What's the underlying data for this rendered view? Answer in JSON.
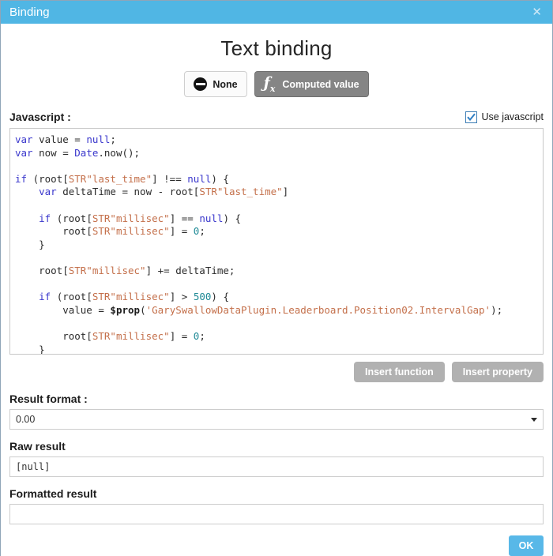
{
  "window": {
    "title": "Binding",
    "close_icon": "close-icon",
    "titlebar_color": "#50b6e4"
  },
  "heading": "Text binding",
  "mode_buttons": [
    {
      "label": "None",
      "icon": "no-entry-icon",
      "selected": false
    },
    {
      "label": "Computed value",
      "icon": "fx-icon",
      "selected": true
    }
  ],
  "javascript_section": {
    "label": "Javascript :",
    "use_javascript_label": "Use javascript",
    "use_javascript_checked": true,
    "code": "var value = null;\nvar now = Date.now();\n\nif (root[\"last_time\"] !== null) {\n    var deltaTime = now - root[\"last_time\"]\n\n    if (root[\"millisec\"] == null) {\n        root[\"millisec\"] = 0;\n    }\n\n    root[\"millisec\"] += deltaTime;\n\n    if (root[\"millisec\"] > 500) {\n        value = $prop('GarySwallowDataPlugin.Leaderboard.Position02.IntervalGap');\n\n        root[\"millisec\"] = 0;\n    }\n}\nroot[\"last_time\"] = now;\nreturn value;"
  },
  "insert_buttons": {
    "insert_function": "Insert function",
    "insert_property": "Insert property"
  },
  "result_format": {
    "label": "Result format :",
    "value": "0.00"
  },
  "raw_result": {
    "label": "Raw result",
    "value": "[null]"
  },
  "formatted_result": {
    "label": "Formatted result",
    "value": ""
  },
  "footer": {
    "ok_label": "OK",
    "ok_color": "#58b8e8"
  }
}
